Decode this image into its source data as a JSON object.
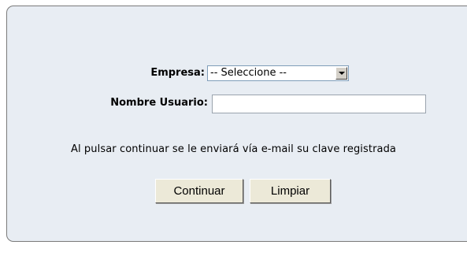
{
  "form": {
    "empresa_label": "Empresa:",
    "empresa_select": {
      "selected": "-- Seleccione --"
    },
    "usuario_label": "Nombre Usuario:",
    "usuario_input": {
      "value": ""
    },
    "note": "Al pulsar continuar se le enviará vía e-mail su clave registrada",
    "continuar_label": "Continuar",
    "limpiar_label": "Limpiar"
  },
  "colors": {
    "panel_bg": "#e8edf3",
    "panel_border": "#7a7a7a",
    "button_face": "#ece9d8"
  },
  "icons": {
    "select_arrow": "chevron-down-icon"
  }
}
